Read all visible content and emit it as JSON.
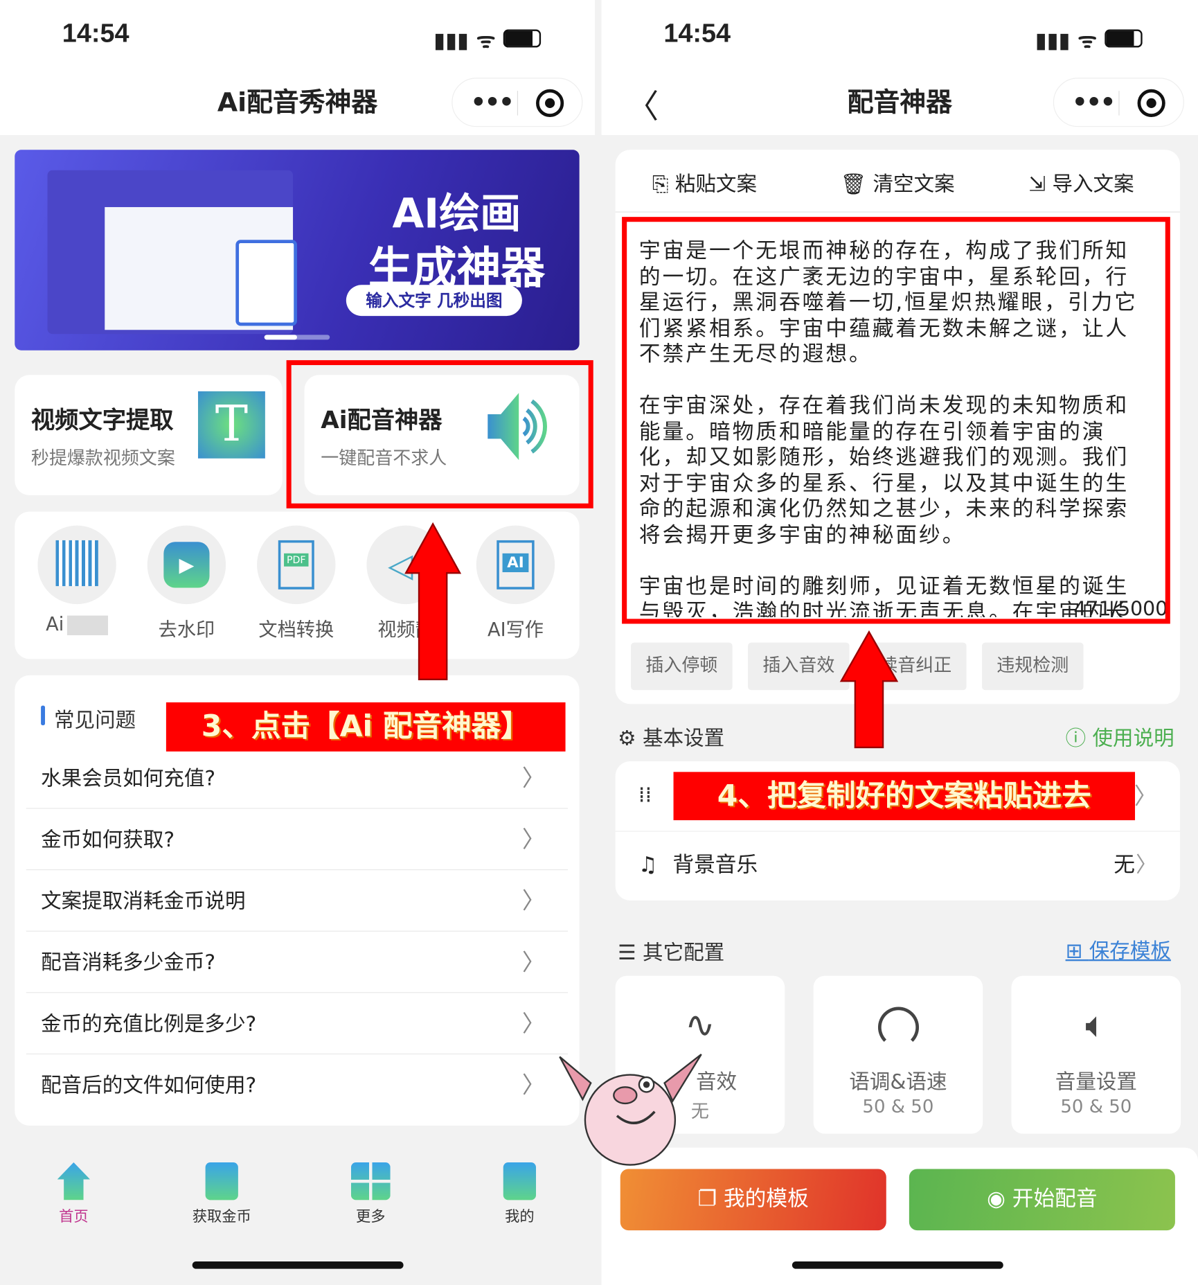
{
  "left": {
    "status_time": "14:54",
    "nav_title": "Ai配音秀神器",
    "banner": {
      "title_line1": "AI绘画",
      "title_line2": "生成神器",
      "tagline": "输入文字 几秒出图"
    },
    "feature_cards": [
      {
        "title": "视频文字提取",
        "subtitle": "秒提爆款视频文案",
        "icon": "text-T-icon"
      },
      {
        "title": "Ai配音神器",
        "subtitle": "一键配音不求人",
        "icon": "speaker-icon"
      }
    ],
    "tools": [
      {
        "label": "Ai",
        "icon": "barcode-search-icon"
      },
      {
        "label": "去水印",
        "icon": "video-play-icon"
      },
      {
        "label": "文档转换",
        "icon": "pdf-icon"
      },
      {
        "label": "视频静",
        "icon": "mute-icon"
      },
      {
        "label": "AI写作",
        "icon": "ai-doc-icon"
      }
    ],
    "faq_title": "常见问题",
    "faq_items": [
      "水果会员如何充值?",
      "金币如何获取?",
      "文案提取消耗金币说明",
      "配音消耗多少金币?",
      "金币的充值比例是多少?",
      "配音后的文件如何使用?"
    ],
    "annotation": "3、点击【Ai 配音神器】",
    "tabbar": [
      {
        "label": "首页",
        "icon": "home-icon",
        "active": true
      },
      {
        "label": "获取金币",
        "icon": "link-icon"
      },
      {
        "label": "更多",
        "icon": "grid-icon"
      },
      {
        "label": "我的",
        "icon": "user-icon"
      }
    ],
    "active_color": "#c0358f"
  },
  "right": {
    "status_time": "14:54",
    "nav_title": "配音神器",
    "toolbar": [
      "粘贴文案",
      "清空文案",
      "导入文案"
    ],
    "text_paragraphs": [
      "宇宙是一个无垠而神秘的存在，构成了我们所知的一切。在这广袤无边的宇宙中，星系轮回，行星运行，黑洞吞噬着一切,恒星炽热耀眼，引力它们紧紧相系。宇宙中蕴藏着无数未解之谜，让人不禁产生无尽的遐想。",
      "在宇宙深处，存在着我们尚未发现的未知物质和能量。暗物质和暗能量的存在引领着宇宙的演化，却又如影随形，始终逃避我们的观测。我们对于宇宙众多的星系、行星，以及其中诞生的生命的起源和演化仍然知之甚少，未来的科学探索将会揭开更多宇宙的神秘面纱。",
      "宇宙也是时间的雕刻师，见证着无数恒星的诞生与毁灭，浩瀚的时光流逝无声无息。在宇宙的长河中"
    ],
    "char_count": "471/5000",
    "chips": [
      "插入停顿",
      "插入音效",
      "读音纠正",
      "违规检测"
    ],
    "basic_settings": "基本设置",
    "help_link": "使用说明",
    "bg_music_label": "背景音乐",
    "bg_music_value": "无",
    "annotation": "4、把复制好的文案粘贴进去",
    "other_settings": "其它配置",
    "save_template": "保存模板",
    "option_cards": [
      {
        "label": "音效",
        "value": "无",
        "icon": "waveform-icon"
      },
      {
        "label": "语调&语速",
        "value": "50 & 50",
        "icon": "speedometer-icon"
      },
      {
        "label": "音量设置",
        "value": "50 & 50",
        "icon": "volume-icon"
      }
    ],
    "my_templates": "我的模板",
    "start_dubbing": "开始配音",
    "help_color": "#4caf50",
    "link_color": "#3b82d6"
  }
}
